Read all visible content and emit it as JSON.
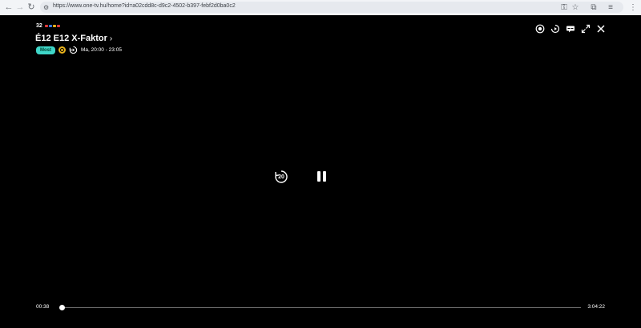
{
  "browser": {
    "url": "https://www.one-tv.hu/home?id=a02cdd8c-d9c2-4502-b397-febf2d0ba0c2",
    "icons": {
      "back": "arrow-left-icon",
      "forward": "arrow-right-icon",
      "reload": "reload-icon",
      "site_info": "tune-icon",
      "key": "key-icon",
      "bookmark": "star-icon",
      "extensions": "puzzle-icon",
      "media": "media-control-icon",
      "menu": "kebab-menu-icon"
    }
  },
  "player": {
    "channel_number": "32",
    "title": "É12 E12 X-Faktor",
    "now_badge": "Most",
    "time_range": "Ma, 20:00 - 23:05",
    "rewind_seconds": "20",
    "current_time": "00:38",
    "total_time": "3:04:22",
    "progress": 0.0035,
    "colors": {
      "accent_badge": "#3fd6c8",
      "ring_icon": "#e8b21c"
    }
  }
}
